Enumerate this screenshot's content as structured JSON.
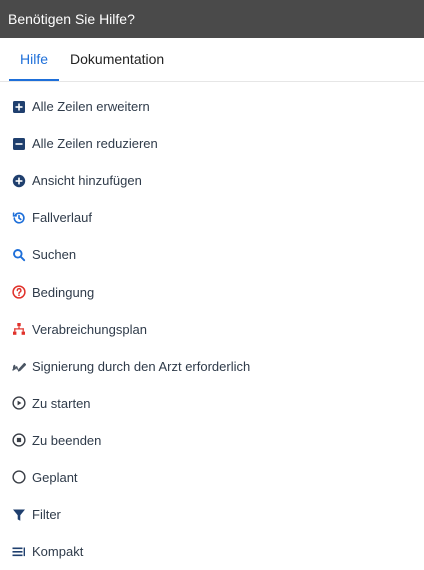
{
  "header": {
    "title": "Benötigen Sie Hilfe?"
  },
  "tabs": [
    {
      "label": "Hilfe",
      "active": true
    },
    {
      "label": "Dokumentation",
      "active": false
    }
  ],
  "items": [
    {
      "label": "Alle Zeilen erweitern",
      "icon": "plus-square-icon"
    },
    {
      "label": "Alle Zeilen reduzieren",
      "icon": "minus-square-icon"
    },
    {
      "label": "Ansicht hinzufügen",
      "icon": "plus-circle-icon"
    },
    {
      "label": "Fallverlauf",
      "icon": "history-icon"
    },
    {
      "label": "Suchen",
      "icon": "search-icon"
    },
    {
      "label": "Bedingung",
      "icon": "question-circle-icon"
    },
    {
      "label": "Verabreichungsplan",
      "icon": "hierarchy-icon"
    },
    {
      "label": "Signierung durch den Arzt erforderlich",
      "icon": "signature-icon"
    },
    {
      "label": "Zu starten",
      "icon": "play-circle-icon"
    },
    {
      "label": "Zu beenden",
      "icon": "stop-circle-icon"
    },
    {
      "label": "Geplant",
      "icon": "empty-circle-icon"
    },
    {
      "label": "Filter",
      "icon": "filter-icon"
    },
    {
      "label": "Kompakt",
      "icon": "compact-icon"
    }
  ],
  "colors": {
    "header_bg": "#4a4a4a",
    "accent": "#1e6fd9",
    "icon_dark": "#1f3f6e",
    "icon_red": "#e0322b",
    "text": "#2f3b4a"
  }
}
